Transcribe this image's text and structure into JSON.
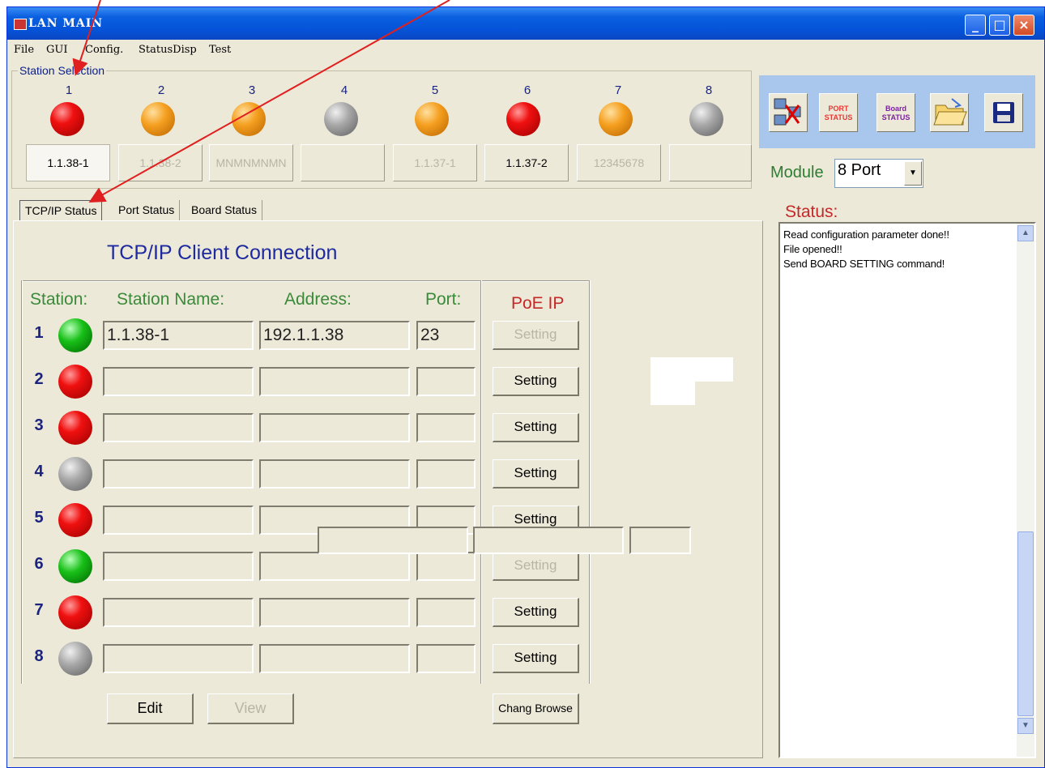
{
  "window": {
    "title": "LAN MAIN"
  },
  "menu": [
    "File",
    "GUI",
    "Config.",
    "StatusDisp",
    "Test"
  ],
  "station_selection": {
    "title": "Station Selection",
    "stations": [
      {
        "num": "1",
        "led": "red",
        "label": "1.1.38-1",
        "state": "active"
      },
      {
        "num": "2",
        "led": "orange",
        "label": "1.1.38-2",
        "state": "disabled"
      },
      {
        "num": "3",
        "led": "orange",
        "label": "MNMNMNMN",
        "state": "disabled"
      },
      {
        "num": "4",
        "led": "gray",
        "label": "",
        "state": "normal"
      },
      {
        "num": "5",
        "led": "orange",
        "label": "1.1.37-1",
        "state": "disabled"
      },
      {
        "num": "6",
        "led": "red",
        "label": "1.1.37-2",
        "state": "normal"
      },
      {
        "num": "7",
        "led": "orange",
        "label": "12345678",
        "state": "disabled"
      },
      {
        "num": "8",
        "led": "gray",
        "label": "",
        "state": "normal"
      }
    ]
  },
  "toolbar": {
    "buttons": [
      {
        "name": "network-icon",
        "text": ""
      },
      {
        "name": "port-status-icon",
        "text": "PORT\nSTATUS",
        "color": "#e53935"
      },
      {
        "name": "board-status-icon",
        "text": "Board\nSTATUS",
        "color": "#7b1fa2"
      },
      {
        "name": "open-folder-icon",
        "text": ""
      },
      {
        "name": "save-disk-icon",
        "text": ""
      }
    ]
  },
  "module": {
    "label": "Module",
    "value": "8 Port"
  },
  "tabs": [
    "TCP/IP Status",
    "Port Status",
    "Board Status"
  ],
  "tcpip": {
    "title": "TCP/IP Client Connection",
    "headers": {
      "station": "Station:",
      "name": "Station Name:",
      "address": "Address:",
      "port": "Port:",
      "poe": "PoE IP"
    },
    "rows": [
      {
        "num": "1",
        "led": "green",
        "name": "1.1.38-1",
        "address": "192.1.1.38",
        "port": "23",
        "setting": "Setting",
        "setting_enabled": false
      },
      {
        "num": "2",
        "led": "red",
        "name": "",
        "address": "",
        "port": "",
        "setting": "Setting",
        "setting_enabled": true
      },
      {
        "num": "3",
        "led": "red",
        "name": "",
        "address": "",
        "port": "",
        "setting": "Setting",
        "setting_enabled": true
      },
      {
        "num": "4",
        "led": "gray",
        "name": "",
        "address": "",
        "port": "",
        "setting": "Setting",
        "setting_enabled": true
      },
      {
        "num": "5",
        "led": "red",
        "name": "",
        "address": "",
        "port": "",
        "setting": "Setting",
        "setting_enabled": true
      },
      {
        "num": "6",
        "led": "green",
        "name": "",
        "address": "",
        "port": "",
        "setting": "Setting",
        "setting_enabled": false
      },
      {
        "num": "7",
        "led": "red",
        "name": "",
        "address": "",
        "port": "",
        "setting": "Setting",
        "setting_enabled": true
      },
      {
        "num": "8",
        "led": "gray",
        "name": "",
        "address": "",
        "port": "",
        "setting": "Setting",
        "setting_enabled": true
      }
    ],
    "buttons": {
      "edit": "Edit",
      "view": "View",
      "browse": "Chang Browse"
    }
  },
  "status": {
    "label": "Status:",
    "lines": [
      "Read configuration parameter done!!",
      "File opened!!",
      "Send BOARD SETTING command!"
    ]
  },
  "colors": {
    "annotation_arrow": "#e02020",
    "title_bar": "#0553d8",
    "window_bg": "#ece9d8"
  }
}
